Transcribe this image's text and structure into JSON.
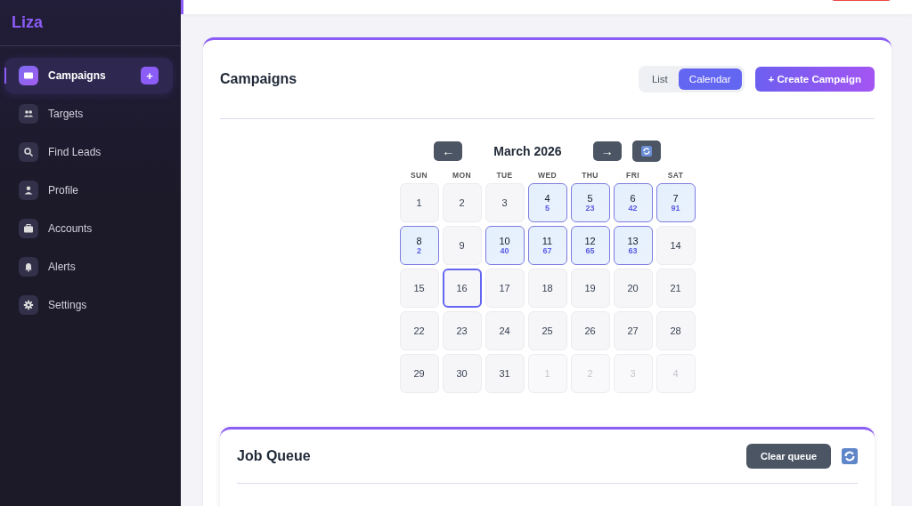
{
  "sidebar": {
    "logo": "Liza",
    "items": [
      {
        "label": "Campaigns",
        "kind": "mail",
        "selected": true,
        "add_button": "+"
      },
      {
        "label": "Targets",
        "kind": "people",
        "selected": false
      },
      {
        "label": "Find Leads",
        "kind": "search",
        "selected": false
      },
      {
        "label": "Profile",
        "kind": "person",
        "selected": false
      },
      {
        "label": "Accounts",
        "kind": "briefcase",
        "selected": false
      },
      {
        "label": "Alerts",
        "kind": "bell",
        "selected": false
      },
      {
        "label": "Settings",
        "kind": "gear",
        "selected": false
      }
    ]
  },
  "campaigns": {
    "title": "Campaigns",
    "view_toggle": [
      {
        "label": "List",
        "selected": false
      },
      {
        "label": "Calendar",
        "selected": true
      }
    ],
    "create_button": "+ Create Campaign",
    "calendar": {
      "prev": "←",
      "month": "March 2026",
      "next": "→",
      "weekdays": [
        "SUN",
        "MON",
        "TUE",
        "WED",
        "THU",
        "FRI",
        "SAT"
      ],
      "days": [
        {
          "day": "1",
          "in_month": true,
          "selected": false
        },
        {
          "day": "2",
          "in_month": true,
          "selected": false
        },
        {
          "day": "3",
          "in_month": true,
          "selected": false
        },
        {
          "day": "4",
          "count": "5",
          "in_month": true,
          "selected": false
        },
        {
          "day": "5",
          "count": "23",
          "in_month": true,
          "selected": false
        },
        {
          "day": "6",
          "count": "42",
          "in_month": true,
          "selected": false
        },
        {
          "day": "7",
          "count": "91",
          "in_month": true,
          "selected": false
        },
        {
          "day": "8",
          "count": "2",
          "in_month": true,
          "selected": false
        },
        {
          "day": "9",
          "in_month": true,
          "selected": false
        },
        {
          "day": "10",
          "count": "40",
          "in_month": true,
          "selected": false
        },
        {
          "day": "11",
          "count": "67",
          "in_month": true,
          "selected": false
        },
        {
          "day": "12",
          "count": "65",
          "in_month": true,
          "selected": false
        },
        {
          "day": "13",
          "count": "63",
          "in_month": true,
          "selected": false
        },
        {
          "day": "14",
          "in_month": true,
          "selected": false
        },
        {
          "day": "15",
          "in_month": true,
          "selected": false
        },
        {
          "day": "16",
          "in_month": true,
          "selected": true
        },
        {
          "day": "17",
          "in_month": true,
          "selected": false
        },
        {
          "day": "18",
          "in_month": true,
          "selected": false
        },
        {
          "day": "19",
          "in_month": true,
          "selected": false
        },
        {
          "day": "20",
          "in_month": true,
          "selected": false
        },
        {
          "day": "21",
          "in_month": true,
          "selected": false
        },
        {
          "day": "22",
          "in_month": true,
          "selected": false
        },
        {
          "day": "23",
          "in_month": true,
          "selected": false
        },
        {
          "day": "24",
          "in_month": true,
          "selected": false
        },
        {
          "day": "25",
          "in_month": true,
          "selected": false
        },
        {
          "day": "26",
          "in_month": true,
          "selected": false
        },
        {
          "day": "27",
          "in_month": true,
          "selected": false
        },
        {
          "day": "28",
          "in_month": true,
          "selected": false
        },
        {
          "day": "29",
          "in_month": true,
          "selected": false
        },
        {
          "day": "30",
          "in_month": true,
          "selected": false
        },
        {
          "day": "31",
          "in_month": true,
          "selected": false
        },
        {
          "day": "1",
          "in_month": false,
          "selected": false
        },
        {
          "day": "2",
          "in_month": false,
          "selected": false
        },
        {
          "day": "3",
          "in_month": false,
          "selected": false
        },
        {
          "day": "4",
          "in_month": false,
          "selected": false
        }
      ]
    }
  },
  "job_queue": {
    "title": "Job Queue",
    "clear_button": "Clear queue"
  }
}
